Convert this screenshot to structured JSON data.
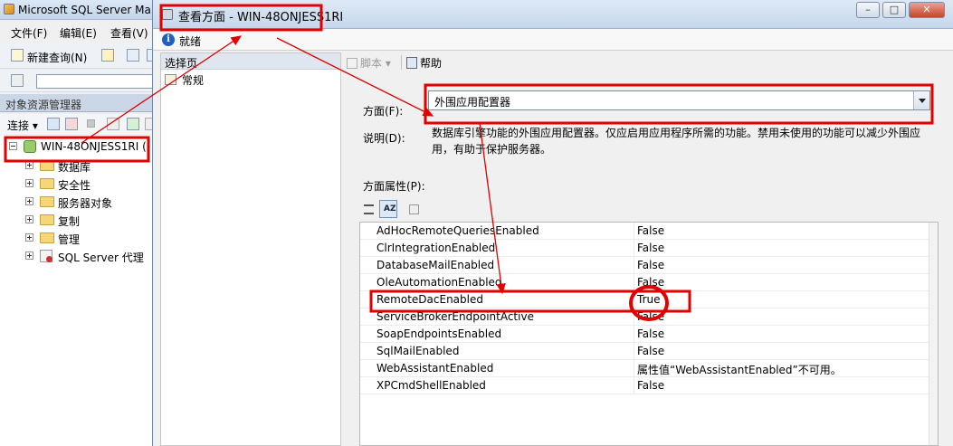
{
  "ssms": {
    "title": "Microsoft SQL Server Ma",
    "menu": [
      "文件(F)",
      "编辑(E)",
      "查看(V)"
    ],
    "new_query": "新建查询(N)",
    "object_explorer_title": "对象资源管理器",
    "connect_label": "连接",
    "server_node": "WIN-48ONJESS1RI (",
    "tree_items": [
      "数据库",
      "安全性",
      "服务器对象",
      "复制",
      "管理",
      "SQL Server 代理"
    ]
  },
  "dialog": {
    "title": "查看方面 - WIN-48ONJESS1RI",
    "status": "就绪",
    "select_page_header": "选择页",
    "page_general": "常规",
    "toolbar": {
      "script": "脚本",
      "help": "帮助"
    },
    "facet_label": "方面(F):",
    "facet_value": "外围应用配置器",
    "description_label": "说明(D):",
    "description_text": "数据库引擎功能的外围应用配置器。仅应启用应用程序所需的功能。禁用未使用的功能可以减少外围应用，有助于保护服务器。",
    "facet_properties_label": "方面属性(P):",
    "properties": [
      {
        "name": "AdHocRemoteQueriesEnabled",
        "value": "False"
      },
      {
        "name": "ClrIntegrationEnabled",
        "value": "False"
      },
      {
        "name": "DatabaseMailEnabled",
        "value": "False"
      },
      {
        "name": "OleAutomationEnabled",
        "value": "False"
      },
      {
        "name": "RemoteDacEnabled",
        "value": "True"
      },
      {
        "name": "ServiceBrokerEndpointActive",
        "value": "False"
      },
      {
        "name": "SoapEndpointsEnabled",
        "value": "False"
      },
      {
        "name": "SqlMailEnabled",
        "value": "False"
      },
      {
        "name": "WebAssistantEnabled",
        "value": "属性值“WebAssistantEnabled”不可用。"
      },
      {
        "name": "XPCmdShellEnabled",
        "value": "False"
      }
    ]
  },
  "colors": {
    "annotation_red": "#e00000",
    "title_bar": "#c6d7ec",
    "selection": "#dbe8f7"
  }
}
